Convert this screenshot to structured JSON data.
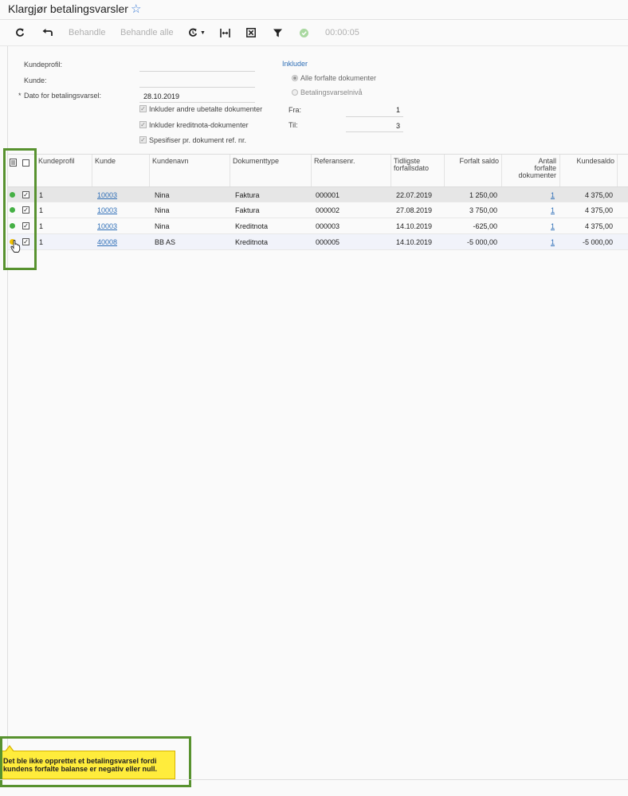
{
  "page": {
    "title": "Klargjør betalingsvarsler",
    "favorite_icon": "star-outline-icon"
  },
  "toolbar": {
    "refresh_icon": "refresh-icon",
    "undo_icon": "undo-icon",
    "process_label": "Behandle",
    "process_all_label": "Behandle alle",
    "schedule_icon": "schedule-refresh-icon",
    "fit_width_icon": "fit-width-icon",
    "export_icon": "export-excel-icon",
    "filter_icon": "filter-icon",
    "status_icon": "check-circle-icon",
    "timer": "00:00:05"
  },
  "form": {
    "customer_profile_label": "Kundeprofil:",
    "customer_profile_value": "",
    "customer_label": "Kunde:",
    "customer_value": "",
    "date_required_mark": "*",
    "date_label": "Dato for betalingsvarsel:",
    "date_value": "28.10.2019",
    "include_unpaid_label": "Inkluder andre ubetalte dokumenter",
    "include_credit_label": "Inkluder kreditnota-dokumenter",
    "specify_ref_label": "Spesifiser pr. dokument ref. nr.",
    "include_heading": "Inkluder",
    "radio_all_label": "Alle forfalte dokumenter",
    "radio_level_label": "Betalingsvarselnivå",
    "from_label": "Fra:",
    "from_value": "1",
    "to_label": "Til:",
    "to_value": "3"
  },
  "grid": {
    "headers": {
      "status_icon": "document-status-icon",
      "profile": "Kundeprofil",
      "customer": "Kunde",
      "customer_name": "Kundenavn",
      "doc_type": "Dokumenttype",
      "ref_no": "Referansenr.",
      "earliest_due_l1": "Tidligste",
      "earliest_due_l2": "forfallsdato",
      "due_balance": "Forfalt saldo",
      "count_l1": "Antall",
      "count_l2": "forfalte",
      "count_l3": "dokumenter",
      "customer_balance": "Kundesaldo"
    },
    "rows": [
      {
        "profile": "1",
        "customer": "10003",
        "name": "Nina",
        "doc_type": "Faktura",
        "ref": "000001",
        "due_date": "22.07.2019",
        "due_balance": "1 250,00",
        "count": "1",
        "balance": "4 375,00"
      },
      {
        "profile": "1",
        "customer": "10003",
        "name": "Nina",
        "doc_type": "Faktura",
        "ref": "000002",
        "due_date": "27.08.2019",
        "due_balance": "3 750,00",
        "count": "1",
        "balance": "4 375,00"
      },
      {
        "profile": "1",
        "customer": "10003",
        "name": "Nina",
        "doc_type": "Kreditnota",
        "ref": "000003",
        "due_date": "14.10.2019",
        "due_balance": "-625,00",
        "count": "1",
        "balance": "4 375,00"
      },
      {
        "profile": "1",
        "customer": "40008",
        "name": "BB AS",
        "doc_type": "Kreditnota",
        "ref": "000005",
        "due_date": "14.10.2019",
        "due_balance": "-5 000,00",
        "count": "1",
        "balance": "-5 000,00"
      }
    ]
  },
  "tooltip": {
    "line1": "Det ble ikke opprettet et betalingsvarsel fordi",
    "line2": "kundens forfalte balanse er negativ eller null."
  },
  "colors": {
    "accent_green": "#58922f",
    "ok_green": "#45b045",
    "tooltip_yellow": "#ffec3c",
    "link_blue": "#2f6fb7",
    "selected_row": "#e6e6e6"
  }
}
